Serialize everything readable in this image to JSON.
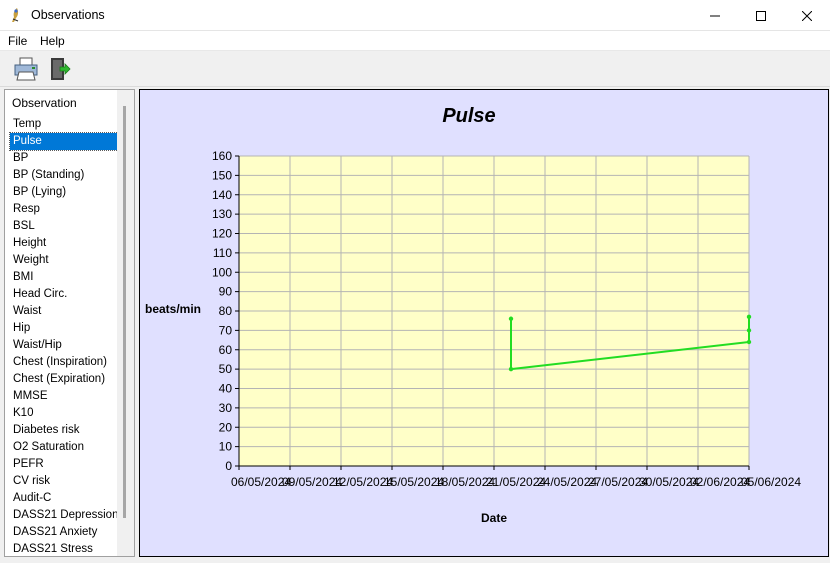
{
  "window": {
    "title": "Observations"
  },
  "menu": {
    "items": [
      "File",
      "Help"
    ]
  },
  "sidebar": {
    "header": "Observation",
    "selected_index": 1,
    "items": [
      "Temp",
      "Pulse",
      "BP",
      "BP (Standing)",
      "BP (Lying)",
      "Resp",
      "BSL",
      "Height",
      "Weight",
      "BMI",
      "Head Circ.",
      "Waist",
      "Hip",
      "Waist/Hip",
      "Chest (Inspiration)",
      "Chest (Expiration)",
      "MMSE",
      "K10",
      "Diabetes risk",
      "O2 Saturation",
      "PEFR",
      "CV risk",
      "Audit-C",
      "DASS21 Depression",
      "DASS21 Anxiety",
      "DASS21 Stress"
    ]
  },
  "chart": {
    "title": "Pulse",
    "ylabel": "beats/min",
    "xlabel": "Date"
  },
  "chart_data": {
    "type": "line",
    "title": "Pulse",
    "xlabel": "Date",
    "ylabel": "beats/min",
    "ylim": [
      0,
      160
    ],
    "yticks": [
      0,
      10,
      20,
      30,
      40,
      50,
      60,
      70,
      80,
      90,
      100,
      110,
      120,
      130,
      140,
      150,
      160
    ],
    "xlim": [
      "2024-05-06",
      "2024-06-05"
    ],
    "xtick_labels": [
      "06/05/2024",
      "09/05/2024",
      "12/05/2024",
      "15/05/2024",
      "18/05/2024",
      "21/05/2024",
      "24/05/2024",
      "27/05/2024",
      "30/05/2024",
      "02/06/2024",
      "05/06/2024"
    ],
    "grid": true,
    "background_color": "#ffffc8",
    "line_color": "#22dd22",
    "series": [
      {
        "points": [
          {
            "x": "2024-05-22",
            "y": 76
          },
          {
            "x": "2024-05-22",
            "y": 50
          },
          {
            "x": "2024-06-05",
            "y": 64
          },
          {
            "x": "2024-06-05",
            "y": 70
          },
          {
            "x": "2024-06-05",
            "y": 77
          }
        ]
      }
    ]
  }
}
